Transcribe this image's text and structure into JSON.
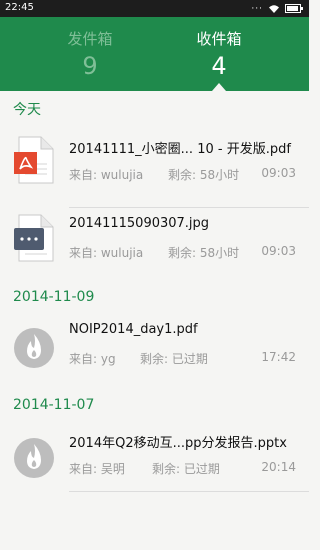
{
  "status_bar": {
    "time": "22:45"
  },
  "tabs": {
    "sent": {
      "label": "发件箱",
      "count": "9"
    },
    "received": {
      "label": "收件箱",
      "count": "4"
    }
  },
  "colors": {
    "brand": "#1f8a4c",
    "pdf": "#e4492f",
    "doc": "#4f5b6f",
    "expired": "#bdbdbd"
  },
  "sections": [
    {
      "title": "今天",
      "items": [
        {
          "icon": "pdf-file-icon",
          "name": "20141111_小密圈... 10 - 开发版.pdf",
          "from": "来自: wulujia",
          "remaining": "剩余: 58小时",
          "time": "09:03"
        },
        {
          "icon": "image-file-icon",
          "name": "20141115090307.jpg",
          "from": "来自: wulujia",
          "remaining": "剩余: 58小时",
          "time": "09:03"
        }
      ]
    },
    {
      "title": "2014-11-09",
      "items": [
        {
          "icon": "expired-fire-icon",
          "name": "NOIP2014_day1.pdf",
          "from": "来自: yg",
          "remaining": "剩余: 已过期",
          "time": "17:42"
        }
      ]
    },
    {
      "title": "2014-11-07",
      "items": [
        {
          "icon": "expired-fire-icon",
          "name": "2014年Q2移动互...pp分发报告.pptx",
          "from": "来自: 吴明",
          "remaining": "剩余: 已过期",
          "time": "20:14"
        }
      ]
    }
  ]
}
